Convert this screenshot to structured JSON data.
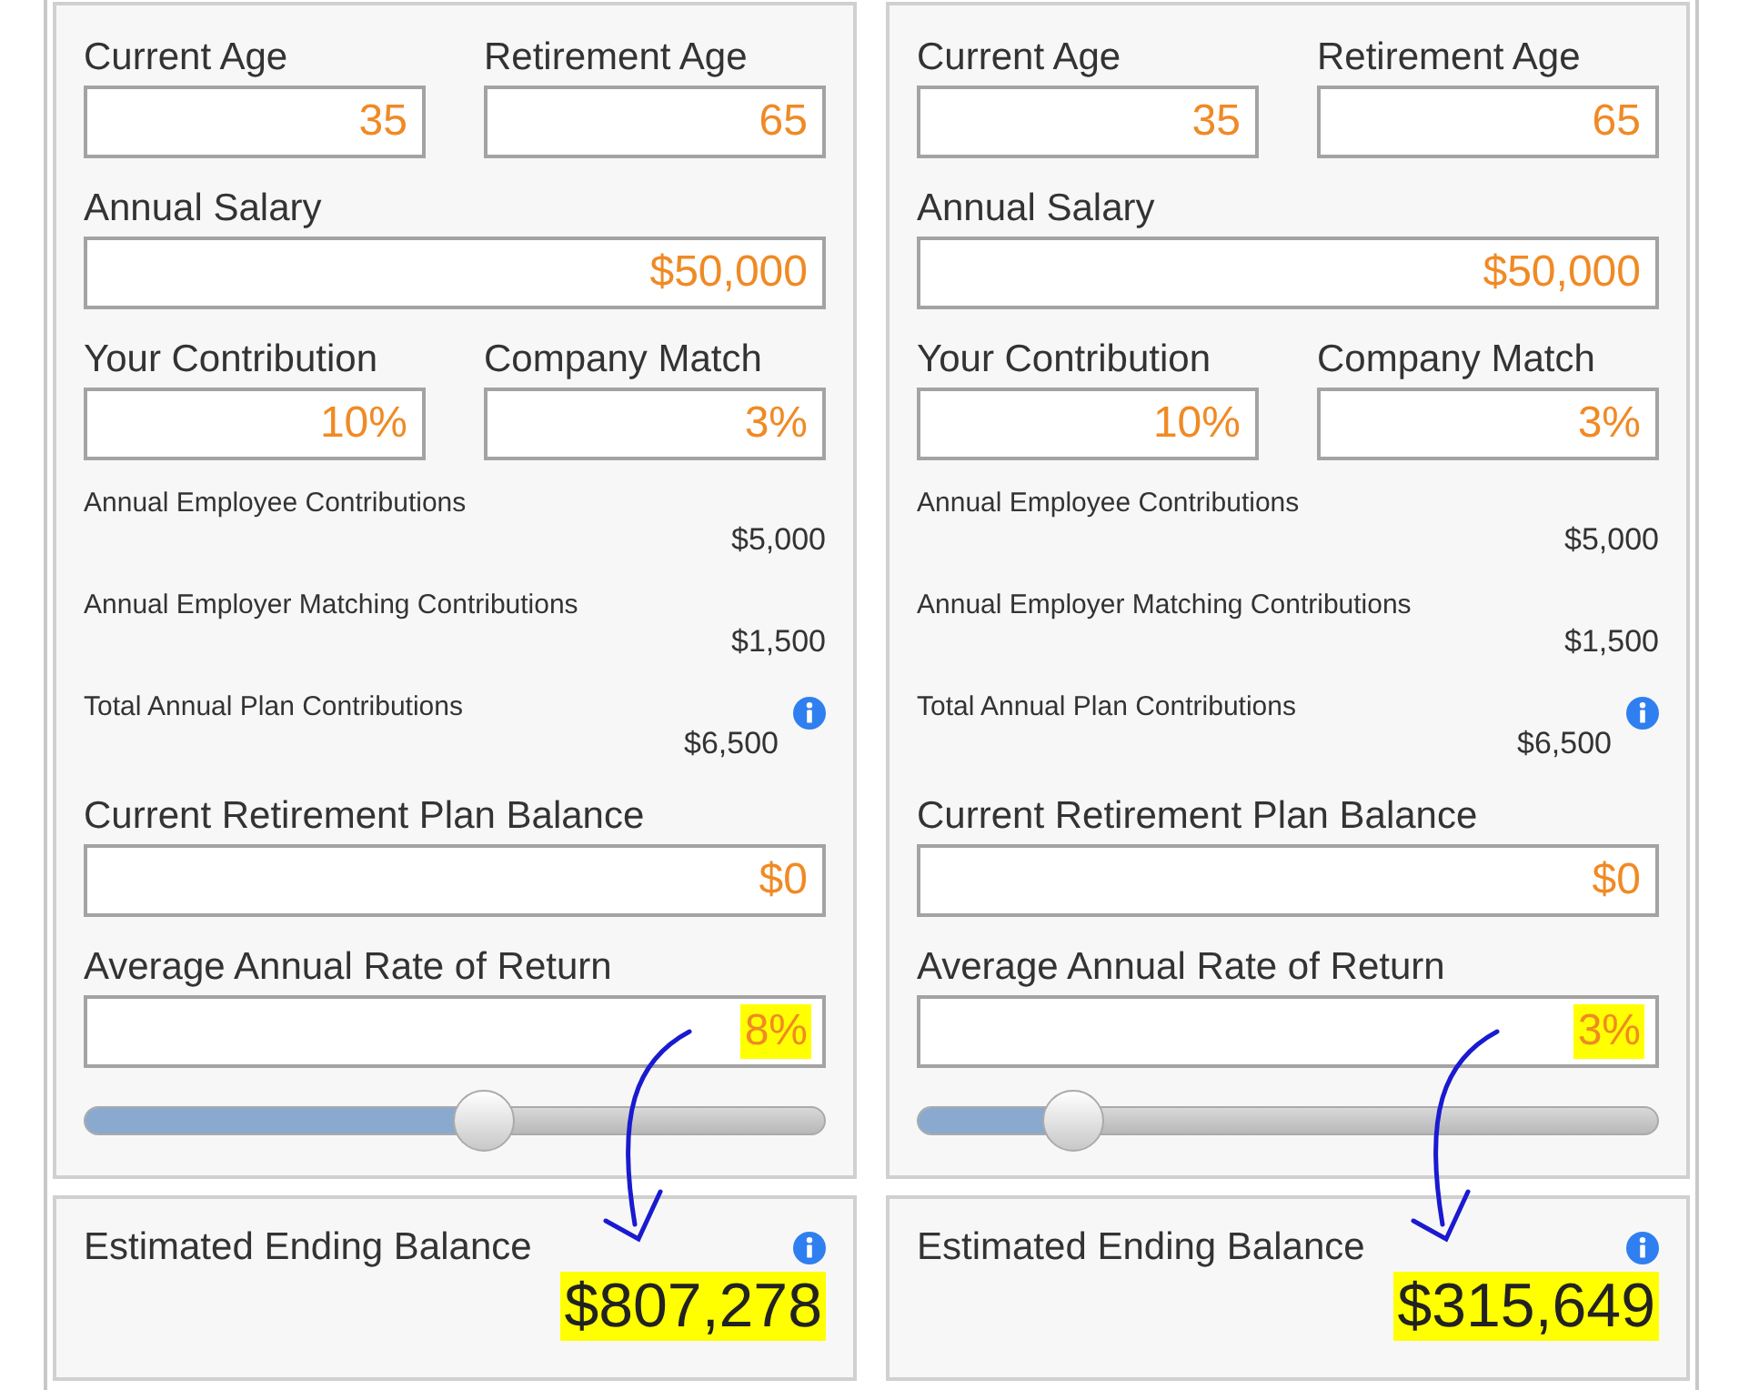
{
  "panels": [
    {
      "current_age": {
        "label": "Current Age",
        "value": "35"
      },
      "retirement_age": {
        "label": "Retirement Age",
        "value": "65"
      },
      "annual_salary": {
        "label": "Annual Salary",
        "value": "$50,000"
      },
      "your_contribution": {
        "label": "Your Contribution",
        "value": "10%"
      },
      "company_match": {
        "label": "Company Match",
        "value": "3%"
      },
      "summary": [
        {
          "label": "Annual Employee Contributions",
          "value": "$5,000",
          "info": false
        },
        {
          "label": "Annual Employer Matching Contributions",
          "value": "$1,500",
          "info": false
        },
        {
          "label": "Total Annual Plan Contributions",
          "value": "$6,500",
          "info": true
        }
      ],
      "current_balance": {
        "label": "Current Retirement Plan Balance",
        "value": "$0"
      },
      "rate_of_return": {
        "label": "Average Annual Rate of Return",
        "value": "8%",
        "highlighted": true,
        "level": 0.54
      },
      "ending_balance": {
        "label": "Estimated Ending Balance",
        "value": "$807,278",
        "highlighted": true
      }
    },
    {
      "current_age": {
        "label": "Current Age",
        "value": "35"
      },
      "retirement_age": {
        "label": "Retirement Age",
        "value": "65"
      },
      "annual_salary": {
        "label": "Annual Salary",
        "value": "$50,000"
      },
      "your_contribution": {
        "label": "Your Contribution",
        "value": "10%"
      },
      "company_match": {
        "label": "Company Match",
        "value": "3%"
      },
      "summary": [
        {
          "label": "Annual Employee Contributions",
          "value": "$5,000",
          "info": false
        },
        {
          "label": "Annual Employer Matching Contributions",
          "value": "$1,500",
          "info": false
        },
        {
          "label": "Total Annual Plan Contributions",
          "value": "$6,500",
          "info": true
        }
      ],
      "current_balance": {
        "label": "Current Retirement Plan Balance",
        "value": "$0"
      },
      "rate_of_return": {
        "label": "Average Annual Rate of Return",
        "value": "3%",
        "highlighted": true,
        "level": 0.21
      },
      "ending_balance": {
        "label": "Estimated Ending Balance",
        "value": "$315,649",
        "highlighted": true
      }
    }
  ]
}
